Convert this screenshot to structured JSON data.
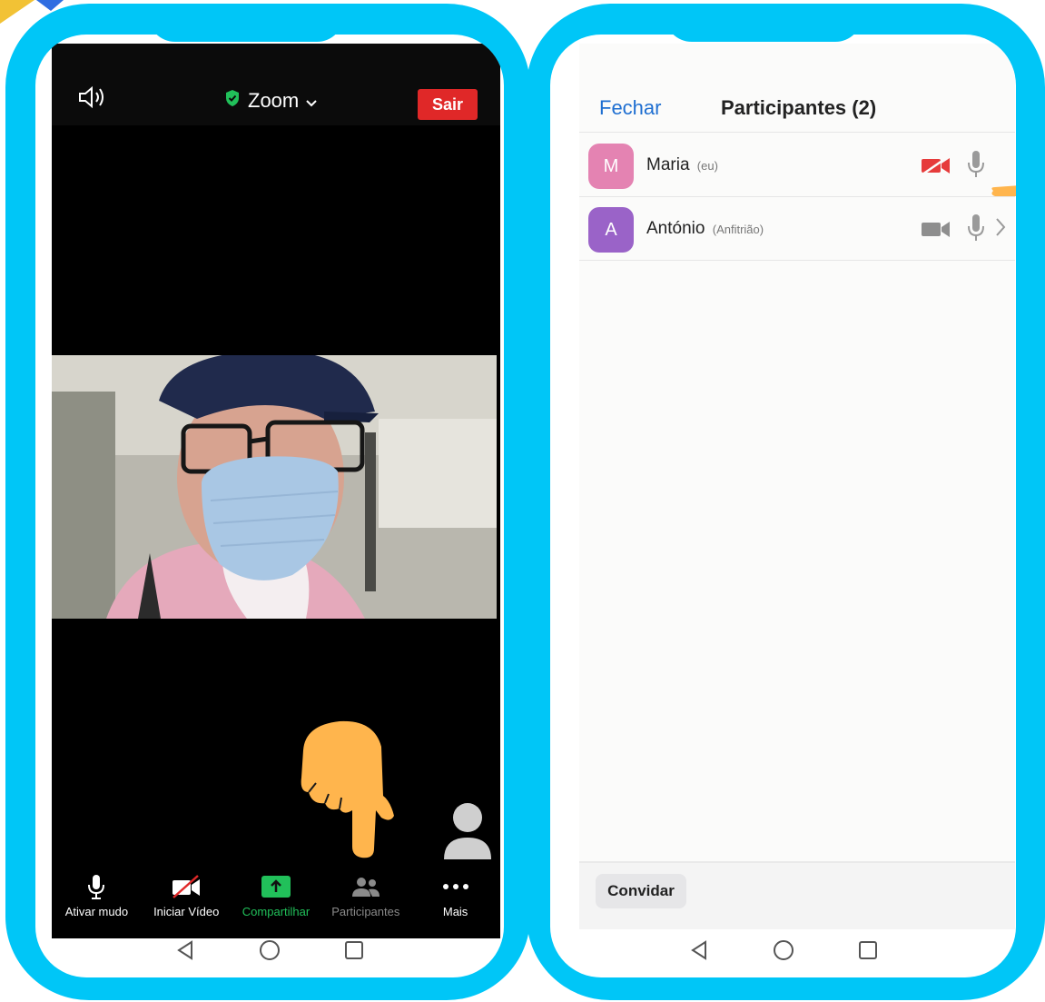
{
  "left_phone": {
    "zoom": {
      "title": "Zoom",
      "leave_label": "Sair",
      "toolbar": [
        {
          "label": "Ativar mudo",
          "icon": "microphone-icon"
        },
        {
          "label": "Iniciar Vídeo",
          "icon": "video-off-icon"
        },
        {
          "label": "Compartilhar",
          "icon": "share-icon"
        },
        {
          "label": "Participantes",
          "icon": "participants-icon"
        },
        {
          "label": "Mais",
          "icon": "more-icon"
        }
      ]
    },
    "nav": [
      "back-icon",
      "home-icon",
      "recents-icon"
    ]
  },
  "right_phone": {
    "close_label": "Fechar",
    "title": "Participantes (2)",
    "participants": [
      {
        "initial": "M",
        "name": "Maria",
        "tag": "(eu)",
        "avatar_color": "#e483b2",
        "video": "off"
      },
      {
        "initial": "A",
        "name": "António",
        "tag": "(Anfitrião)",
        "avatar_color": "#9a63c8",
        "video": "on"
      }
    ],
    "invite_label": "Convidar"
  },
  "colors": {
    "frame": "#00c6f7",
    "leave": "#e02828",
    "share_green": "#21c05a",
    "link_blue": "#1f6fd1",
    "hand": "#ffb54d"
  }
}
